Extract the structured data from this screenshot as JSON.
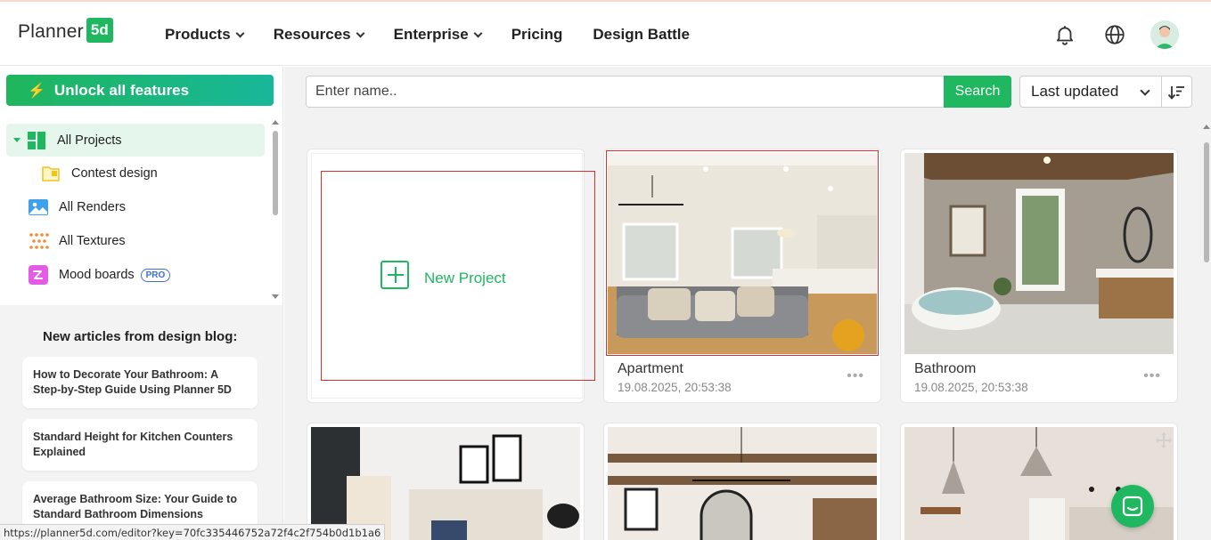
{
  "header": {
    "logo_text": "Planner",
    "logo_badge": "5d",
    "nav": [
      {
        "label": "Products",
        "has_dropdown": true
      },
      {
        "label": "Resources",
        "has_dropdown": true
      },
      {
        "label": "Enterprise",
        "has_dropdown": true
      },
      {
        "label": "Pricing",
        "has_dropdown": false
      },
      {
        "label": "Design Battle",
        "has_dropdown": false
      }
    ],
    "icons": [
      "bell-icon",
      "globe-icon",
      "avatar"
    ]
  },
  "sidebar": {
    "unlock_label": "Unlock all features",
    "items": [
      {
        "label": "All Projects",
        "icon": "folder-grid-icon",
        "active": true
      },
      {
        "label": "Contest design",
        "icon": "folder-icon"
      },
      {
        "label": "All Renders",
        "icon": "image-icon"
      },
      {
        "label": "All Textures",
        "icon": "texture-dots-icon"
      },
      {
        "label": "Mood boards",
        "icon": "moodboard-icon",
        "badge": "PRO"
      }
    ],
    "blog": {
      "title": "New articles from design blog:",
      "articles": [
        "How to Decorate Your Bathroom: A Step-by-Step Guide Using Planner 5D",
        "Standard Height for Kitchen Counters Explained",
        "Average Bathroom Size: Your Guide to Standard Bathroom Dimensions"
      ]
    }
  },
  "toolbar": {
    "search_placeholder": "Enter name..",
    "search_button": "Search",
    "sort_value": "Last updated"
  },
  "projects": {
    "new_project_label": "New Project",
    "items": [
      {
        "name": "Apartment",
        "date": "19.08.2025, 20:53:38"
      },
      {
        "name": "Bathroom",
        "date": "19.08.2025, 20:53:38"
      }
    ],
    "more_glyph": "•••"
  },
  "status_bar": {
    "url": "https://planner5d.com/editor?key=70fc335446752a72f4c2f754b0d1b1a6"
  },
  "colors": {
    "brand_green": "#1fb75f",
    "highlight_red": "#d8302f",
    "pro_blue": "#3b6fd9"
  }
}
